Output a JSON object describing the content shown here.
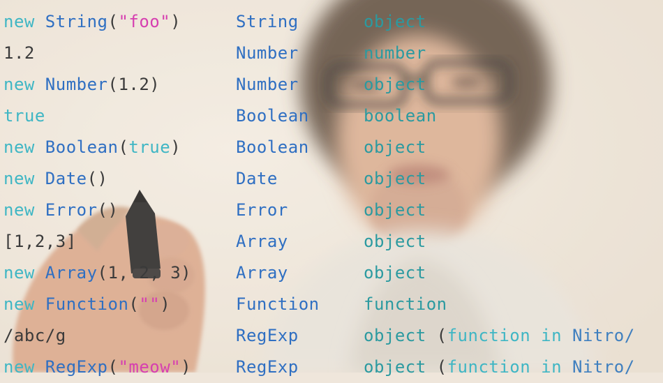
{
  "rows": [
    {
      "expr": [
        {
          "t": "new ",
          "c": "kw"
        },
        {
          "t": "String",
          "c": "ty"
        },
        {
          "t": "(",
          "c": "pl"
        },
        {
          "t": "\"foo\"",
          "c": "st"
        },
        {
          "t": ")",
          "c": "pl"
        }
      ],
      "ctor": "String",
      "typeof": "object"
    },
    {
      "expr": [
        {
          "t": "1.2",
          "c": "pl"
        }
      ],
      "ctor": "Number",
      "typeof": "number"
    },
    {
      "expr": [
        {
          "t": "new ",
          "c": "kw"
        },
        {
          "t": "Number",
          "c": "ty"
        },
        {
          "t": "(1.2)",
          "c": "pl"
        }
      ],
      "ctor": "Number",
      "typeof": "object"
    },
    {
      "expr": [
        {
          "t": "true",
          "c": "kw"
        }
      ],
      "ctor": "Boolean",
      "typeof": "boolean"
    },
    {
      "expr": [
        {
          "t": "new ",
          "c": "kw"
        },
        {
          "t": "Boolean",
          "c": "ty"
        },
        {
          "t": "(",
          "c": "pl"
        },
        {
          "t": "true",
          "c": "kw"
        },
        {
          "t": ")",
          "c": "pl"
        }
      ],
      "ctor": "Boolean",
      "typeof": "object"
    },
    {
      "expr": [
        {
          "t": "new ",
          "c": "kw"
        },
        {
          "t": "Date",
          "c": "ty"
        },
        {
          "t": "()",
          "c": "pl"
        }
      ],
      "ctor": "Date",
      "typeof": "object"
    },
    {
      "expr": [
        {
          "t": "new ",
          "c": "kw"
        },
        {
          "t": "Error",
          "c": "ty"
        },
        {
          "t": "()",
          "c": "pl"
        }
      ],
      "ctor": "Error",
      "typeof": "object"
    },
    {
      "expr": [
        {
          "t": "[1,2,3]",
          "c": "pl"
        }
      ],
      "ctor": "Array",
      "typeof": "object"
    },
    {
      "expr": [
        {
          "t": "new ",
          "c": "kw"
        },
        {
          "t": "Array",
          "c": "ty"
        },
        {
          "t": "(1, 2, 3)",
          "c": "pl"
        }
      ],
      "ctor": "Array",
      "typeof": "object"
    },
    {
      "expr": [
        {
          "t": "new ",
          "c": "kw"
        },
        {
          "t": "Function",
          "c": "ty"
        },
        {
          "t": "(",
          "c": "pl"
        },
        {
          "t": "\"\"",
          "c": "st"
        },
        {
          "t": ")",
          "c": "pl"
        }
      ],
      "ctor": "Function",
      "typeof": "function"
    },
    {
      "expr": [
        {
          "t": "/abc/g",
          "c": "pl"
        }
      ],
      "ctor": "RegExp",
      "typeof": "object",
      "note": [
        {
          "t": "(",
          "c": "pl"
        },
        {
          "t": "function in ",
          "c": "k"
        },
        {
          "t": "Nitro/",
          "c": "nm"
        }
      ]
    },
    {
      "expr": [
        {
          "t": "new ",
          "c": "kw"
        },
        {
          "t": "RegExp",
          "c": "ty"
        },
        {
          "t": "(",
          "c": "pl"
        },
        {
          "t": "\"meow\"",
          "c": "st"
        },
        {
          "t": ")",
          "c": "pl"
        }
      ],
      "ctor": "RegExp",
      "typeof": "object",
      "note": [
        {
          "t": "(",
          "c": "pl"
        },
        {
          "t": "function in ",
          "c": "k"
        },
        {
          "t": "Nitro/",
          "c": "nm"
        }
      ]
    }
  ],
  "colors": {
    "background": "#efe6db",
    "keyword": "#3fb6c4",
    "type": "#2f6fc2",
    "string": "#d63fb0",
    "typeof": "#2b9aa0"
  }
}
